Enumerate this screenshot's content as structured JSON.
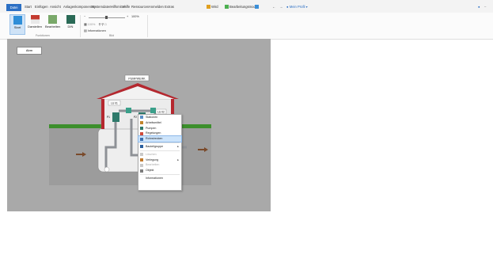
{
  "menu": {
    "file": "Datei",
    "items": [
      "Start",
      "Einfügen",
      "Ansicht",
      "Anlagenkomponenten",
      "Systemdaten",
      "Hilfsmittel",
      "Hilfe",
      "Ressourcen",
      "Anmelden",
      "Extras"
    ],
    "qat": {
      "save": "Wird",
      "editmode": "Bearbeitungsmodus",
      "profile": "Mein Profil"
    }
  },
  "ribbon": {
    "buttons": [
      {
        "label": "Start",
        "selected": true
      },
      {
        "label": "Darstellen"
      },
      {
        "label": "Bearbeiten"
      },
      {
        "label": "DIN"
      }
    ],
    "zoom_value": "100%",
    "zoom_label": "100%",
    "info_label": "Informationen",
    "groups": [
      "Funktionen",
      "Bild"
    ]
  },
  "canvas": {
    "top_button": "Abm",
    "building_label": "PUMPWERK",
    "pump_labels": [
      "LU 01",
      "P1",
      "P2",
      "LU 02"
    ]
  },
  "context_menu": {
    "items": [
      {
        "label": "Stationen",
        "icon": "station-icon",
        "state": "normal"
      },
      {
        "label": "Arbeitsmittel",
        "icon": "tools-icon",
        "state": "normal"
      },
      {
        "label": "Pumpen",
        "icon": "pump-icon",
        "state": "normal"
      },
      {
        "label": "Regelungen",
        "icon": "control-icon",
        "state": "normal"
      },
      {
        "label": "Rohrstrecken",
        "icon": "pipe-icon",
        "state": "highlighted"
      },
      {
        "label": "Bauteilgruppe",
        "icon": "group-icon",
        "state": "normal",
        "submenu": true
      },
      {
        "label": "Löschen",
        "icon": "delete-icon",
        "state": "disabled"
      },
      {
        "label": "Verlegung",
        "icon": "route-icon",
        "state": "normal",
        "submenu": true
      },
      {
        "label": "Bearbeiten",
        "icon": "edit-icon",
        "state": "disabled"
      },
      {
        "label": "Objekt",
        "icon": "object-icon",
        "state": "normal"
      },
      {
        "label": "Informationen",
        "icon": "",
        "state": "normal"
      }
    ]
  },
  "colors": {
    "accent": "#2b6fc4",
    "canvas": "#a9a9a9",
    "roof": "#b5282f",
    "grass": "#3c8f2c",
    "pipe": "#8e9196",
    "pump": "#2e7a6b",
    "highlight": "#cde4fb"
  }
}
